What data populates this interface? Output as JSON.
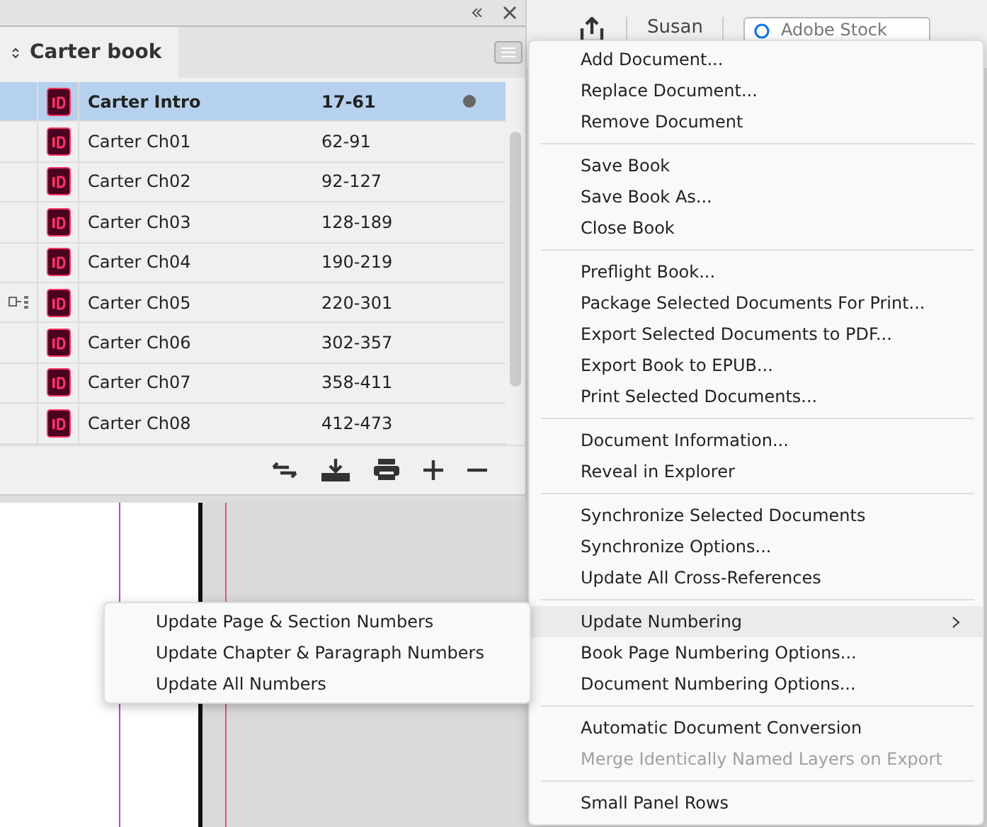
{
  "panel": {
    "title": "Carter book",
    "documents": [
      {
        "name": "Carter Intro",
        "pages": "17-61",
        "selected": true,
        "open": true,
        "style_source": false
      },
      {
        "name": "Carter Ch01",
        "pages": "62-91",
        "selected": false,
        "open": false,
        "style_source": false
      },
      {
        "name": "Carter Ch02",
        "pages": "92-127",
        "selected": false,
        "open": false,
        "style_source": false
      },
      {
        "name": "Carter Ch03",
        "pages": "128-189",
        "selected": false,
        "open": false,
        "style_source": false
      },
      {
        "name": "Carter Ch04",
        "pages": "190-219",
        "selected": false,
        "open": false,
        "style_source": false
      },
      {
        "name": "Carter Ch05",
        "pages": "220-301",
        "selected": false,
        "open": false,
        "style_source": true
      },
      {
        "name": "Carter Ch06",
        "pages": "302-357",
        "selected": false,
        "open": false,
        "style_source": false
      },
      {
        "name": "Carter Ch07",
        "pages": "358-411",
        "selected": false,
        "open": false,
        "style_source": false
      },
      {
        "name": "Carter Ch08",
        "pages": "412-473",
        "selected": false,
        "open": false,
        "style_source": false
      }
    ]
  },
  "app_bar": {
    "user": "Susan",
    "search": {
      "placeholder": "Adobe Stock"
    }
  },
  "menu": [
    [
      {
        "label": "Add Document...",
        "disabled": false,
        "selected": false,
        "submenu": false
      },
      {
        "label": "Replace Document...",
        "disabled": false,
        "selected": false,
        "submenu": false
      },
      {
        "label": "Remove Document",
        "disabled": false,
        "selected": false,
        "submenu": false
      }
    ],
    [
      {
        "label": "Save Book",
        "disabled": false,
        "selected": false,
        "submenu": false
      },
      {
        "label": "Save Book As...",
        "disabled": false,
        "selected": false,
        "submenu": false
      },
      {
        "label": "Close Book",
        "disabled": false,
        "selected": false,
        "submenu": false
      }
    ],
    [
      {
        "label": "Preflight Book...",
        "disabled": false,
        "selected": false,
        "submenu": false
      },
      {
        "label": "Package Selected Documents For Print...",
        "disabled": false,
        "selected": false,
        "submenu": false
      },
      {
        "label": "Export Selected Documents to PDF...",
        "disabled": false,
        "selected": false,
        "submenu": false
      },
      {
        "label": "Export Book to EPUB...",
        "disabled": false,
        "selected": false,
        "submenu": false
      },
      {
        "label": "Print Selected Documents...",
        "disabled": false,
        "selected": false,
        "submenu": false
      }
    ],
    [
      {
        "label": "Document Information...",
        "disabled": false,
        "selected": false,
        "submenu": false
      },
      {
        "label": "Reveal in Explorer",
        "disabled": false,
        "selected": false,
        "submenu": false
      }
    ],
    [
      {
        "label": "Synchronize Selected Documents",
        "disabled": false,
        "selected": false,
        "submenu": false
      },
      {
        "label": "Synchronize Options...",
        "disabled": false,
        "selected": false,
        "submenu": false
      },
      {
        "label": "Update All Cross-References",
        "disabled": false,
        "selected": false,
        "submenu": false
      }
    ],
    [
      {
        "label": "Update Numbering",
        "disabled": false,
        "selected": true,
        "submenu": true
      },
      {
        "label": "Book Page Numbering Options...",
        "disabled": false,
        "selected": false,
        "submenu": false
      },
      {
        "label": "Document Numbering Options...",
        "disabled": false,
        "selected": false,
        "submenu": false
      }
    ],
    [
      {
        "label": "Automatic Document Conversion",
        "disabled": false,
        "selected": false,
        "submenu": false
      },
      {
        "label": "Merge Identically Named Layers on Export",
        "disabled": true,
        "selected": false,
        "submenu": false
      }
    ],
    [
      {
        "label": "Small Panel Rows",
        "disabled": false,
        "selected": false,
        "submenu": false
      }
    ]
  ],
  "submenu": [
    {
      "label": "Update Page & Section Numbers"
    },
    {
      "label": "Update Chapter & Paragraph Numbers"
    },
    {
      "label": "Update All Numbers"
    }
  ]
}
